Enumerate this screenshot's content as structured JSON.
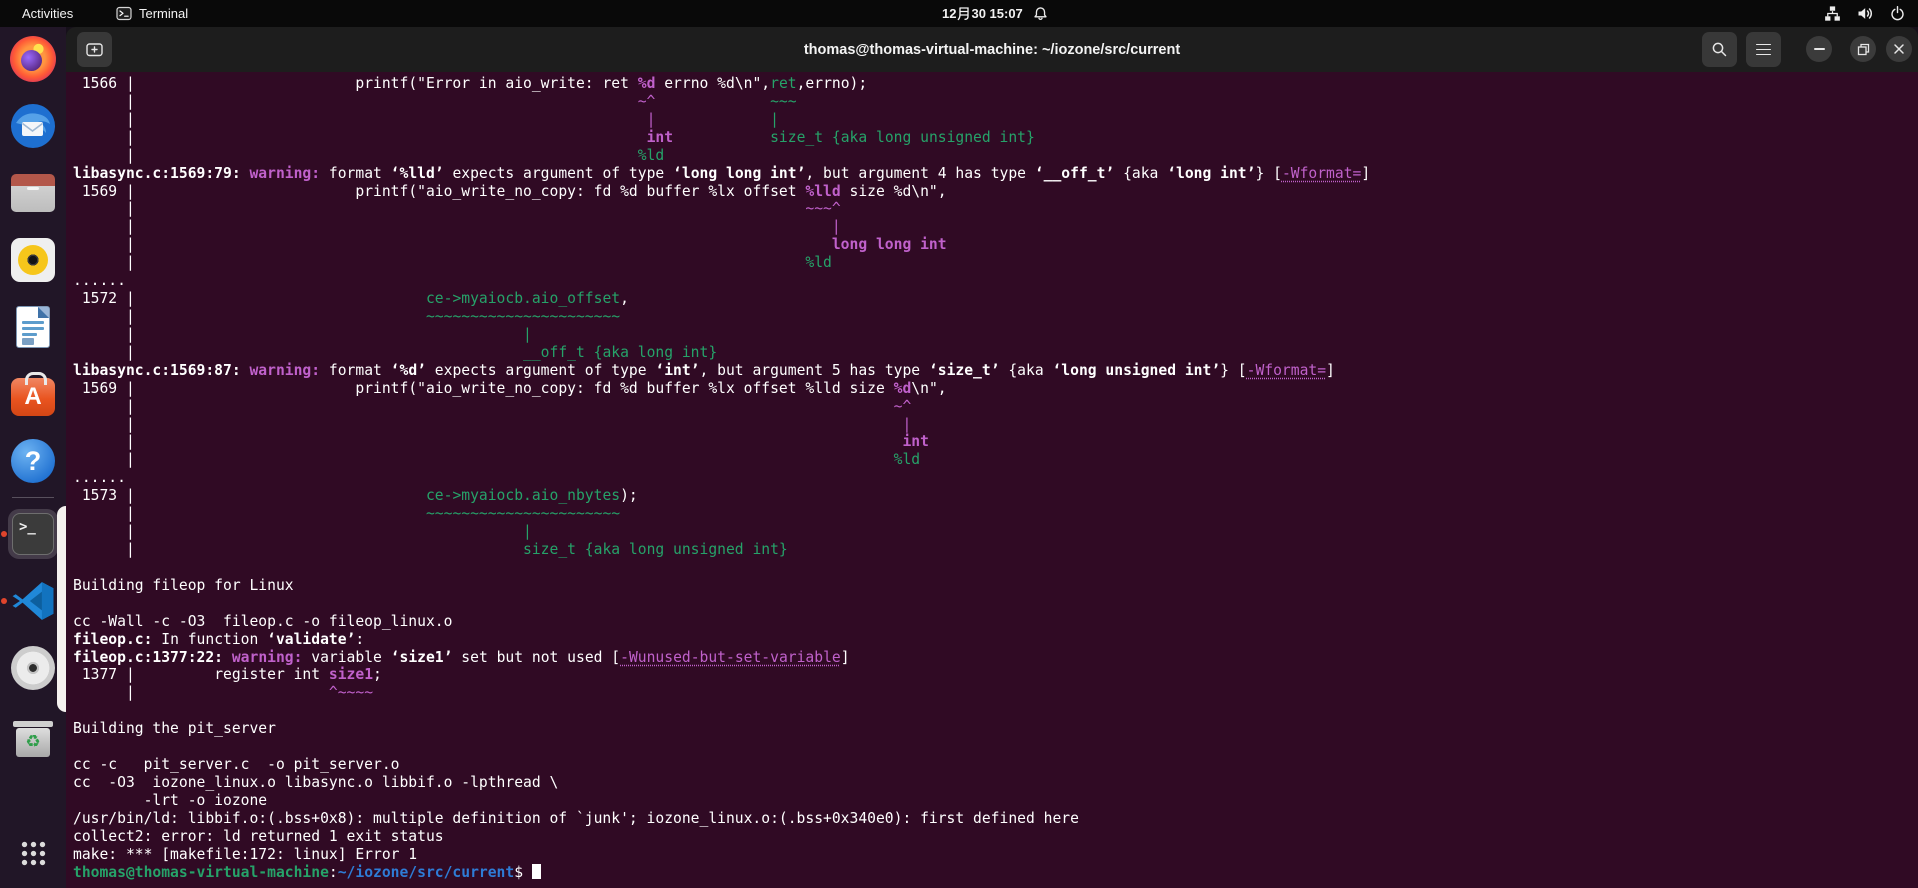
{
  "colors": {
    "terminal_bg": "#300a24",
    "magenta": "#c061cb",
    "green": "#26a269",
    "prompt_blue": "#2e7cd6",
    "titlebar_bg": "#1d1d1d",
    "topbar_bg": "#090909",
    "running_dot": "#e0442c"
  },
  "topbar": {
    "activities_label": "Activities",
    "focused_app_label": "Terminal",
    "clock": "12月 30 15:07",
    "clock_parts": {
      "before_month": "12",
      "rest": " 30 15:07"
    },
    "status_icons": [
      "network-icon",
      "volume-icon",
      "power-icon"
    ]
  },
  "titlebar": {
    "title": "thomas@thomas-virtual-machine: ~/iozone/src/current",
    "buttons": [
      "new-tab",
      "search",
      "menu",
      "minimize",
      "restore",
      "close"
    ]
  },
  "dock": {
    "items": [
      "firefox",
      "thunderbird",
      "files",
      "rhythmbox",
      "libreoffice-writer",
      "app-center",
      "help",
      "terminal",
      "vscode",
      "disc",
      "trash",
      "show-apps"
    ],
    "running": [
      "terminal",
      "vscode"
    ],
    "active": "terminal"
  },
  "terminal": {
    "prompt_user": "thomas@thomas-virtual-machine",
    "prompt_path": "~/iozone/src/current",
    "lines": [
      [
        [
          "w",
          " 1566 | "
        ],
        [
          "p",
          24
        ],
        [
          "w",
          "printf(\"Error in aio_write: ret "
        ],
        [
          "mb",
          "%d"
        ],
        [
          "w",
          " errno %d\\n\","
        ],
        [
          "g",
          "ret"
        ],
        [
          "w",
          ",errno);"
        ]
      ],
      [
        [
          "w",
          "      | "
        ],
        [
          "p",
          56
        ],
        [
          "m",
          "~^"
        ],
        [
          "p",
          13
        ],
        [
          "g",
          "~~~"
        ]
      ],
      [
        [
          "w",
          "      | "
        ],
        [
          "p",
          57
        ],
        [
          "m",
          "|"
        ],
        [
          "p",
          13
        ],
        [
          "g",
          "|"
        ]
      ],
      [
        [
          "w",
          "      | "
        ],
        [
          "p",
          57
        ],
        [
          "mb",
          "int"
        ],
        [
          "p",
          11
        ],
        [
          "g",
          "size_t {aka long unsigned int}"
        ]
      ],
      [
        [
          "w",
          "      | "
        ],
        [
          "p",
          56
        ],
        [
          "g",
          "%ld"
        ]
      ],
      [
        [
          "wb",
          "libasync.c:1569:79:"
        ],
        [
          "w",
          " "
        ],
        [
          "mb",
          "warning:"
        ],
        [
          "w",
          " format "
        ],
        [
          "wb",
          "‘%lld’"
        ],
        [
          "w",
          " expects argument of type "
        ],
        [
          "wb",
          "‘long long int’"
        ],
        [
          "w",
          ", but argument 4 has type "
        ],
        [
          "wb",
          "‘__off_t’"
        ],
        [
          "w",
          " {aka "
        ],
        [
          "wb",
          "‘long int’"
        ],
        [
          "w",
          "} ["
        ],
        [
          "md",
          "-Wformat="
        ],
        [
          "w",
          "]"
        ]
      ],
      [
        [
          "w",
          " 1569 | "
        ],
        [
          "p",
          24
        ],
        [
          "w",
          "printf(\"aio_write_no_copy: fd %d buffer %lx offset "
        ],
        [
          "mb",
          "%lld"
        ],
        [
          "w",
          " size %d\\n\","
        ]
      ],
      [
        [
          "w",
          "      | "
        ],
        [
          "p",
          75
        ],
        [
          "m",
          "~~~^"
        ]
      ],
      [
        [
          "w",
          "      | "
        ],
        [
          "p",
          78
        ],
        [
          "m",
          "|"
        ]
      ],
      [
        [
          "w",
          "      | "
        ],
        [
          "p",
          78
        ],
        [
          "mb",
          "long long int"
        ]
      ],
      [
        [
          "w",
          "      | "
        ],
        [
          "p",
          75
        ],
        [
          "g",
          "%ld"
        ]
      ],
      [
        [
          "w",
          "......"
        ]
      ],
      [
        [
          "w",
          " 1572 | "
        ],
        [
          "p",
          32
        ],
        [
          "g",
          "ce->myaiocb.aio_offset"
        ],
        [
          "w",
          ","
        ]
      ],
      [
        [
          "w",
          "      | "
        ],
        [
          "p",
          32
        ],
        [
          "g",
          "~~~~~~~~~~~~~~~~~~~~~~"
        ]
      ],
      [
        [
          "w",
          "      | "
        ],
        [
          "p",
          43
        ],
        [
          "g",
          "|"
        ]
      ],
      [
        [
          "w",
          "      | "
        ],
        [
          "p",
          43
        ],
        [
          "g",
          "__off_t {aka long int}"
        ]
      ],
      [
        [
          "wb",
          "libasync.c:1569:87:"
        ],
        [
          "w",
          " "
        ],
        [
          "mb",
          "warning:"
        ],
        [
          "w",
          " format "
        ],
        [
          "wb",
          "‘%d’"
        ],
        [
          "w",
          " expects argument of type "
        ],
        [
          "wb",
          "‘int’"
        ],
        [
          "w",
          ", but argument 5 has type "
        ],
        [
          "wb",
          "‘size_t’"
        ],
        [
          "w",
          " {aka "
        ],
        [
          "wb",
          "‘long unsigned int’"
        ],
        [
          "w",
          "} ["
        ],
        [
          "md",
          "-Wformat="
        ],
        [
          "w",
          "]"
        ]
      ],
      [
        [
          "w",
          " 1569 | "
        ],
        [
          "p",
          24
        ],
        [
          "w",
          "printf(\"aio_write_no_copy: fd %d buffer %lx offset %lld size "
        ],
        [
          "mb",
          "%d"
        ],
        [
          "w",
          "\\n\","
        ]
      ],
      [
        [
          "w",
          "      | "
        ],
        [
          "p",
          85
        ],
        [
          "m",
          "~^"
        ]
      ],
      [
        [
          "w",
          "      | "
        ],
        [
          "p",
          86
        ],
        [
          "m",
          "|"
        ]
      ],
      [
        [
          "w",
          "      | "
        ],
        [
          "p",
          86
        ],
        [
          "mb",
          "int"
        ]
      ],
      [
        [
          "w",
          "      | "
        ],
        [
          "p",
          85
        ],
        [
          "g",
          "%ld"
        ]
      ],
      [
        [
          "w",
          "......"
        ]
      ],
      [
        [
          "w",
          " 1573 | "
        ],
        [
          "p",
          32
        ],
        [
          "g",
          "ce->myaiocb.aio_nbytes"
        ],
        [
          "w",
          ");"
        ]
      ],
      [
        [
          "w",
          "      | "
        ],
        [
          "p",
          32
        ],
        [
          "g",
          "~~~~~~~~~~~~~~~~~~~~~~"
        ]
      ],
      [
        [
          "w",
          "      | "
        ],
        [
          "p",
          43
        ],
        [
          "g",
          "|"
        ]
      ],
      [
        [
          "w",
          "      | "
        ],
        [
          "p",
          43
        ],
        [
          "g",
          "size_t {aka long unsigned int}"
        ]
      ],
      [],
      [
        [
          "w",
          "Building fileop for Linux"
        ]
      ],
      [],
      [
        [
          "w",
          "cc -Wall -c -O3  fileop.c -o fileop_linux.o"
        ]
      ],
      [
        [
          "wb",
          "fileop.c:"
        ],
        [
          "w",
          " In function "
        ],
        [
          "wb",
          "‘validate’"
        ],
        [
          "w",
          ":"
        ]
      ],
      [
        [
          "wb",
          "fileop.c:1377:22:"
        ],
        [
          "w",
          " "
        ],
        [
          "mb",
          "warning:"
        ],
        [
          "w",
          " variable "
        ],
        [
          "wb",
          "‘size1’"
        ],
        [
          "w",
          " set but not used ["
        ],
        [
          "md",
          "-Wunused-but-set-variable"
        ],
        [
          "w",
          "]"
        ]
      ],
      [
        [
          "w",
          " 1377 | "
        ],
        [
          "p",
          8
        ],
        [
          "w",
          "register int "
        ],
        [
          "mb",
          "size1"
        ],
        [
          "w",
          ";"
        ]
      ],
      [
        [
          "w",
          "      | "
        ],
        [
          "p",
          21
        ],
        [
          "m",
          "^~~~~"
        ]
      ],
      [],
      [
        [
          "w",
          "Building the pit_server"
        ]
      ],
      [],
      [
        [
          "w",
          "cc -c   pit_server.c  -o pit_server.o"
        ]
      ],
      [
        [
          "w",
          "cc  -O3  iozone_linux.o libasync.o libbif.o -lpthread \\"
        ]
      ],
      [
        [
          "w",
          "        -lrt -o iozone"
        ]
      ],
      [
        [
          "w",
          "/usr/bin/ld: libbif.o:(.bss+0x8): multiple definition of `junk'; iozone_linux.o:(.bss+0x340e0): first defined here"
        ]
      ],
      [
        [
          "w",
          "collect2: error: ld returned 1 exit status"
        ]
      ],
      [
        [
          "w",
          "make: *** [makefile:172: linux] Error 1"
        ]
      ],
      [
        [
          "gb",
          "thomas@thomas-virtual-machine"
        ],
        [
          "w",
          ":"
        ],
        [
          "bb",
          "~/iozone/src/current"
        ],
        [
          "w",
          "$ "
        ],
        [
          "cur",
          ""
        ]
      ]
    ]
  }
}
